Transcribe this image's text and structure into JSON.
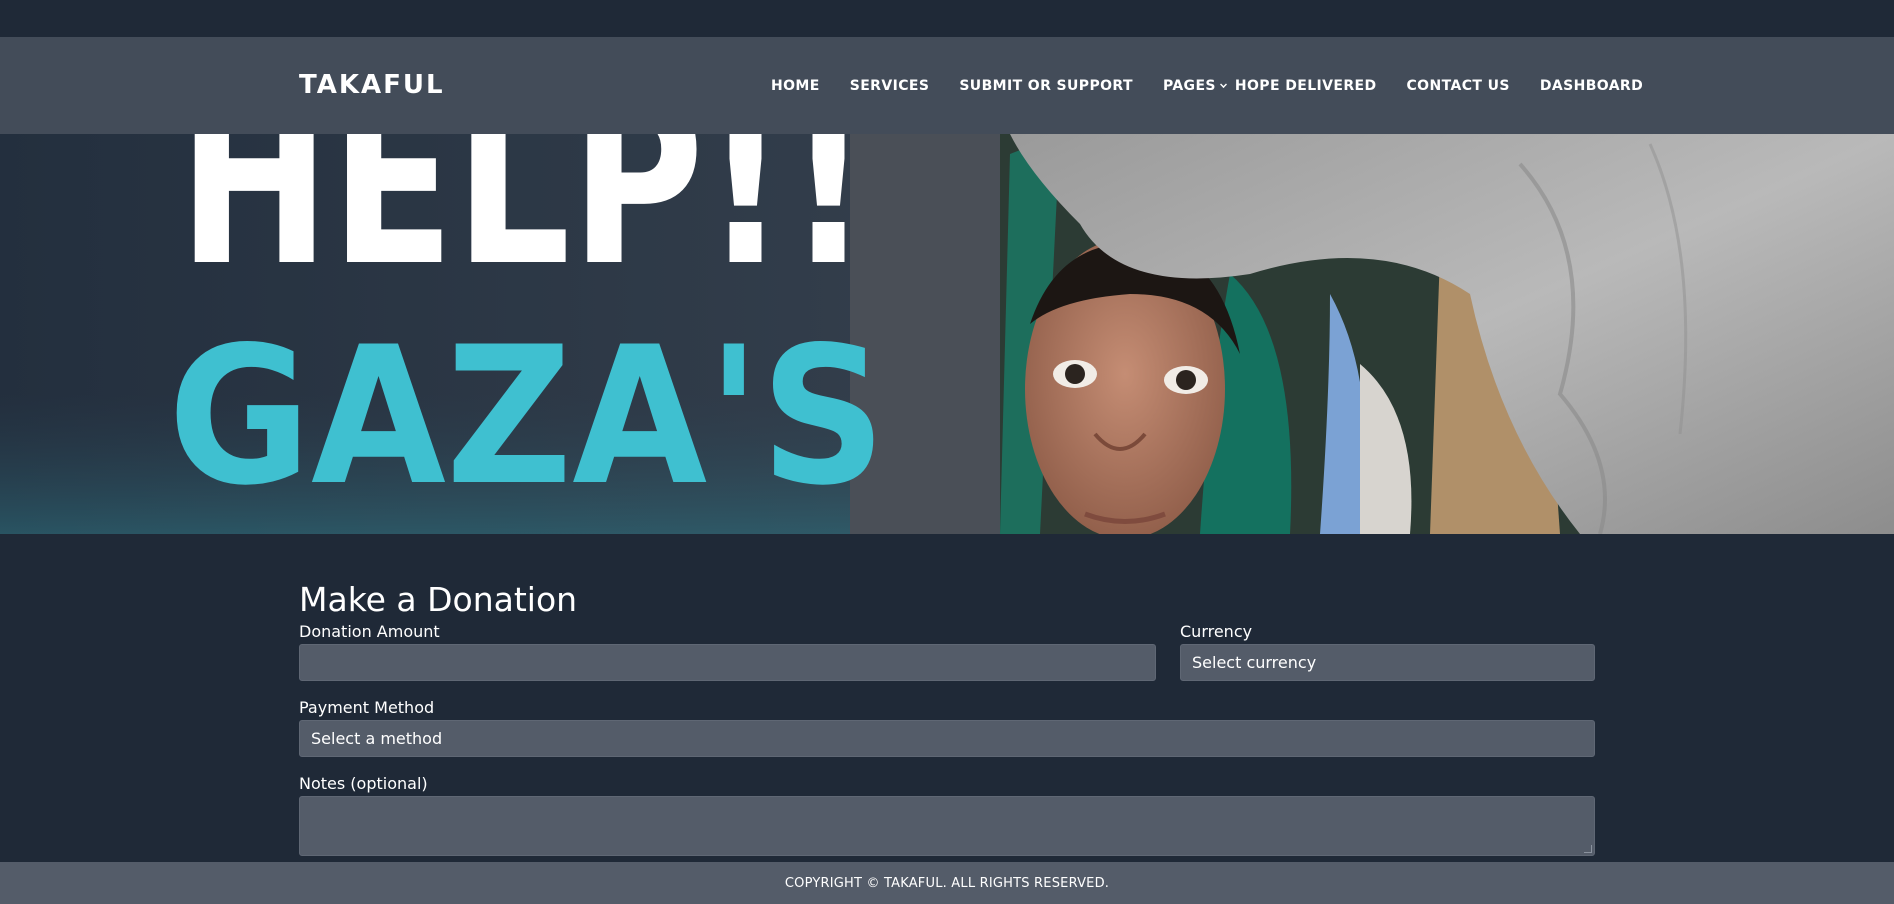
{
  "header": {
    "brand": "TAKAFUL",
    "nav": {
      "home": "HOME",
      "services": "SERVICES",
      "submit": "SUBMIT OR SUPPORT",
      "pages": "PAGES",
      "hope": "HOPE DELIVERED",
      "contact": "CONTACT US",
      "dashboard": "DASHBOARD"
    }
  },
  "hero": {
    "line1": "HELP!!",
    "line2": "GAZA'S"
  },
  "form": {
    "title": "Make a Donation",
    "amount_label": "Donation Amount",
    "amount_value": "",
    "currency_label": "Currency",
    "currency_value": "Select currency",
    "method_label": "Payment Method",
    "method_value": "Select a method",
    "notes_label": "Notes (optional)",
    "notes_value": ""
  },
  "footer": {
    "text": "COPYRIGHT © TAKAFUL. ALL RIGHTS RESERVED."
  },
  "colors": {
    "page_bg": "#1f2937",
    "navbar_bg": "#434c59",
    "input_bg": "#545c69",
    "footer_bg": "#545c69",
    "hero_accent": "#3fc0d0"
  }
}
